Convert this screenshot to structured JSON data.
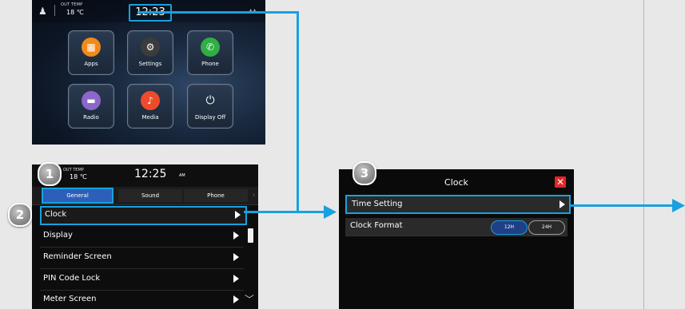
{
  "home": {
    "out_temp_label": "OUT TEMP",
    "out_temp_value": "18 ℃",
    "clock": "12:23",
    "tiles": [
      {
        "label": "Apps",
        "icon": "apps-grid-icon",
        "color": "#f08a1c",
        "glyph": "▦"
      },
      {
        "label": "Settings",
        "icon": "gear-icon",
        "color": "#3c3c3c",
        "glyph": "⚙"
      },
      {
        "label": "Phone",
        "icon": "phone-icon",
        "color": "#2fae45",
        "glyph": "✆"
      },
      {
        "label": "Radio",
        "icon": "radio-icon",
        "color": "#8a67c8",
        "glyph": "▬"
      },
      {
        "label": "Media",
        "icon": "music-note-icon",
        "color": "#ee4b2b",
        "glyph": "♪"
      },
      {
        "label": "Display Off",
        "icon": "power-icon",
        "color": "transparent",
        "glyph": "⏻"
      }
    ]
  },
  "settings": {
    "out_temp_label": "OUT TEMP",
    "out_temp_value": "18 ℃",
    "time": "12:25",
    "ampm": "AM",
    "tabs": [
      "General",
      "Sound",
      "Phone"
    ],
    "rows": [
      "Clock",
      "Display",
      "Reminder Screen",
      "PIN Code Lock",
      "Meter Screen"
    ]
  },
  "clock_dialog": {
    "title": "Clock",
    "time_setting": "Time Setting",
    "clock_format": "Clock Format",
    "format_options": [
      "12H",
      "24H"
    ]
  },
  "steps": [
    "1",
    "2",
    "3"
  ],
  "colors": {
    "accent": "#19a0e0",
    "close": "#e0262a",
    "selected_pill": "#1f3f86"
  }
}
